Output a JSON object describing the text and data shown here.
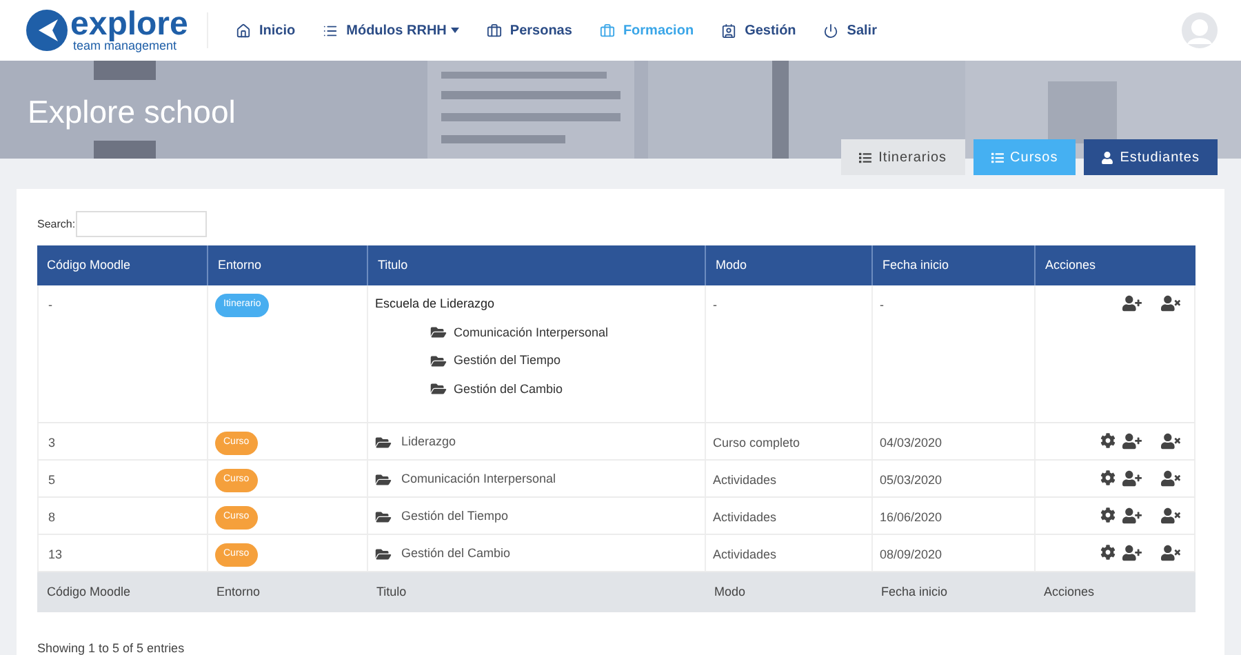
{
  "brand": {
    "name": "explore",
    "tagline": "team management"
  },
  "nav": [
    {
      "label": "Inicio",
      "selected": false,
      "dropdown": false
    },
    {
      "label": "Módulos RRHH",
      "selected": false,
      "dropdown": true
    },
    {
      "label": "Personas",
      "selected": false,
      "dropdown": false
    },
    {
      "label": "Formacion",
      "selected": true,
      "dropdown": false
    },
    {
      "label": "Gestión",
      "selected": false,
      "dropdown": false
    },
    {
      "label": "Salir",
      "selected": false,
      "dropdown": false
    }
  ],
  "banner": {
    "title": "Explore school"
  },
  "view_buttons": [
    {
      "label": "Itinerarios",
      "kind": "light"
    },
    {
      "label": "Cursos",
      "kind": "info"
    },
    {
      "label": "Estudiantes",
      "kind": "primary"
    }
  ],
  "search": {
    "label": "Search:"
  },
  "table": {
    "columns": [
      "Código Moodle",
      "Entorno",
      "Titulo",
      "Modo",
      "Fecha inicio",
      "Acciones"
    ],
    "rows": [
      {
        "code": "-",
        "badge": {
          "label": "Itinerario",
          "kind": "itinerario"
        },
        "title": "Escuela de Liderazgo",
        "children": [
          {
            "title": "Comunicación Interpersonal"
          },
          {
            "title": "Gestión del Tiempo"
          },
          {
            "title": "Gestión del Cambio"
          }
        ],
        "mode": "-",
        "date": "-",
        "actions": [
          {
            "kind": "add-user"
          },
          {
            "kind": "remove-user"
          }
        ]
      },
      {
        "code": "3",
        "badge": {
          "label": "Curso",
          "kind": "curso"
        },
        "title": "Liderazgo",
        "mode": "Curso completo",
        "date": "04/03/2020",
        "actions": [
          {
            "kind": "settings"
          },
          {
            "kind": "add-user"
          },
          {
            "kind": "remove-user"
          }
        ]
      },
      {
        "code": "5",
        "badge": {
          "label": "Curso",
          "kind": "curso"
        },
        "title": "Comunicación Interpersonal",
        "mode": "Actividades",
        "date": "05/03/2020",
        "actions": [
          {
            "kind": "settings"
          },
          {
            "kind": "add-user"
          },
          {
            "kind": "remove-user"
          }
        ]
      },
      {
        "code": "8",
        "badge": {
          "label": "Curso",
          "kind": "curso"
        },
        "title": "Gestión del Tiempo",
        "mode": "Actividades",
        "date": "16/06/2020",
        "actions": [
          {
            "kind": "settings"
          },
          {
            "kind": "add-user"
          },
          {
            "kind": "remove-user"
          }
        ]
      },
      {
        "code": "13",
        "badge": {
          "label": "Curso",
          "kind": "curso"
        },
        "title": "Gestión del Cambio",
        "mode": "Actividades",
        "date": "08/09/2020",
        "actions": [
          {
            "kind": "settings"
          },
          {
            "kind": "add-user"
          },
          {
            "kind": "remove-user"
          }
        ]
      }
    ],
    "footer_columns": [
      "Código Moodle",
      "Entorno",
      "Titulo",
      "Modo",
      "Fecha inicio",
      "Acciones"
    ]
  },
  "info": "Showing 1 to 5 of 5 entries"
}
